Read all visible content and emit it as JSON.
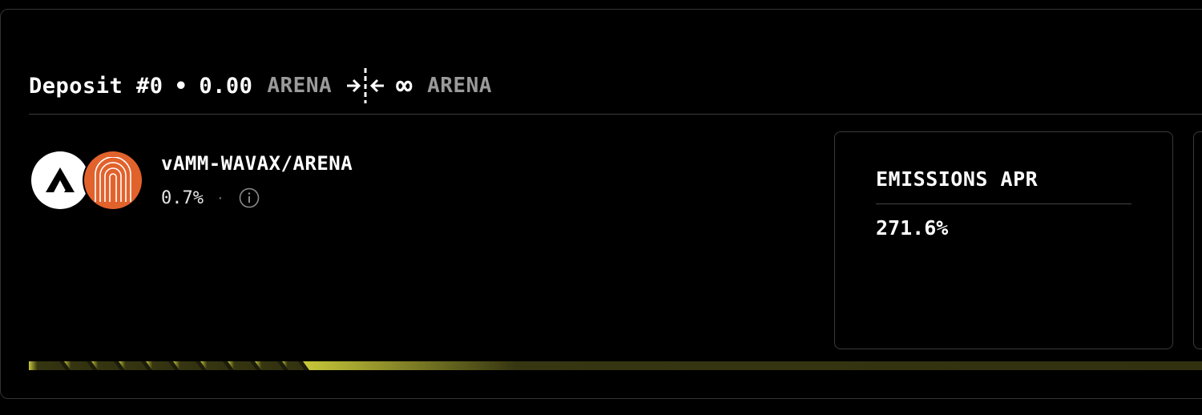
{
  "deposit": {
    "title": "Deposit #0",
    "separator": "•",
    "min_amount": "0.00",
    "min_token": "ARENA",
    "range_icon": "range-arrows-icon",
    "max_amount": "∞",
    "max_token": "ARENA"
  },
  "pool": {
    "token_a_icon": "avalanche-icon",
    "token_b_icon": "arena-icon",
    "name": "vAMM-WAVAX/ARENA",
    "fee": "0.7%",
    "meta_separator": "·",
    "info_icon": "info-icon"
  },
  "stats": {
    "emissions_label": "EMISSIONS APR",
    "emissions_value": "271.6%"
  },
  "colors": {
    "accent": "#c8c83a",
    "token_b": "#e2622c",
    "background": "#000000",
    "border": "#333333"
  }
}
